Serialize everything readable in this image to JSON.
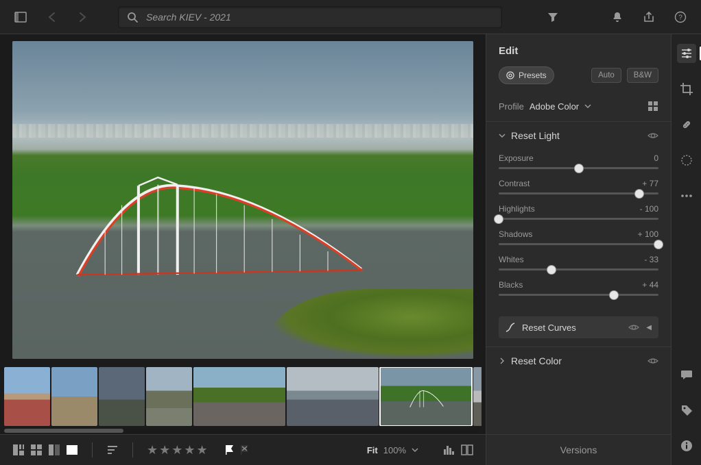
{
  "search": {
    "placeholder": "Search KIEV - 2021"
  },
  "edit": {
    "title": "Edit",
    "presets": "Presets",
    "auto": "Auto",
    "bw": "B&W",
    "profile_label": "Profile",
    "profile_value": "Adobe Color"
  },
  "light": {
    "title": "Reset Light",
    "exposure": {
      "label": "Exposure",
      "display": "0",
      "pct": 50
    },
    "contrast": {
      "label": "Contrast",
      "display": "+ 77",
      "pct": 88
    },
    "highlights": {
      "label": "Highlights",
      "display": "- 100",
      "pct": 0
    },
    "shadows": {
      "label": "Shadows",
      "display": "+ 100",
      "pct": 100
    },
    "whites": {
      "label": "Whites",
      "display": "- 33",
      "pct": 33
    },
    "blacks": {
      "label": "Blacks",
      "display": "+ 44",
      "pct": 72
    }
  },
  "curves": {
    "title": "Reset Curves"
  },
  "color_section": {
    "title": "Reset Color"
  },
  "versions": "Versions",
  "zoom": {
    "fit": "Fit",
    "value": "100%"
  }
}
